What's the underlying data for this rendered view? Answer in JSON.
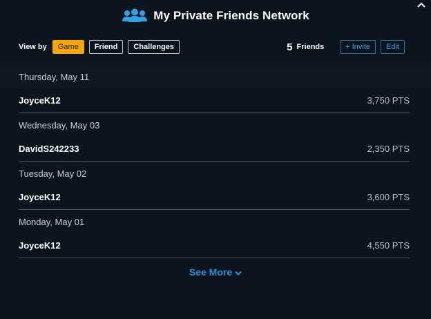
{
  "header": {
    "title": "My Private Friends Network",
    "icon": "people-group-icon",
    "collapse_icon": "chevron-up-icon"
  },
  "toolbar": {
    "view_by_label": "View by",
    "filters": [
      "Game",
      "Friend",
      "Challenges"
    ],
    "active_filter": "Game",
    "friend_count": "5",
    "friends_label": "Friends",
    "invite_label": "+ Invite",
    "edit_label": "Edit"
  },
  "entries": [
    {
      "date": "Thursday, May 11",
      "name": "JoyceK12",
      "points": "3,750 PTS"
    },
    {
      "date": "Wednesday, May 03",
      "name": "DavidS242233",
      "points": "2,350 PTS"
    },
    {
      "date": "Tuesday, May 02",
      "name": "JoyceK12",
      "points": "3,600 PTS"
    },
    {
      "date": "Monday, May 01",
      "name": "JoyceK12",
      "points": "4,550 PTS"
    }
  ],
  "see_more_label": "See More",
  "colors": {
    "background": "#0c141d",
    "accent_yellow": "#f6a800",
    "link_blue": "#2f8fd8"
  }
}
